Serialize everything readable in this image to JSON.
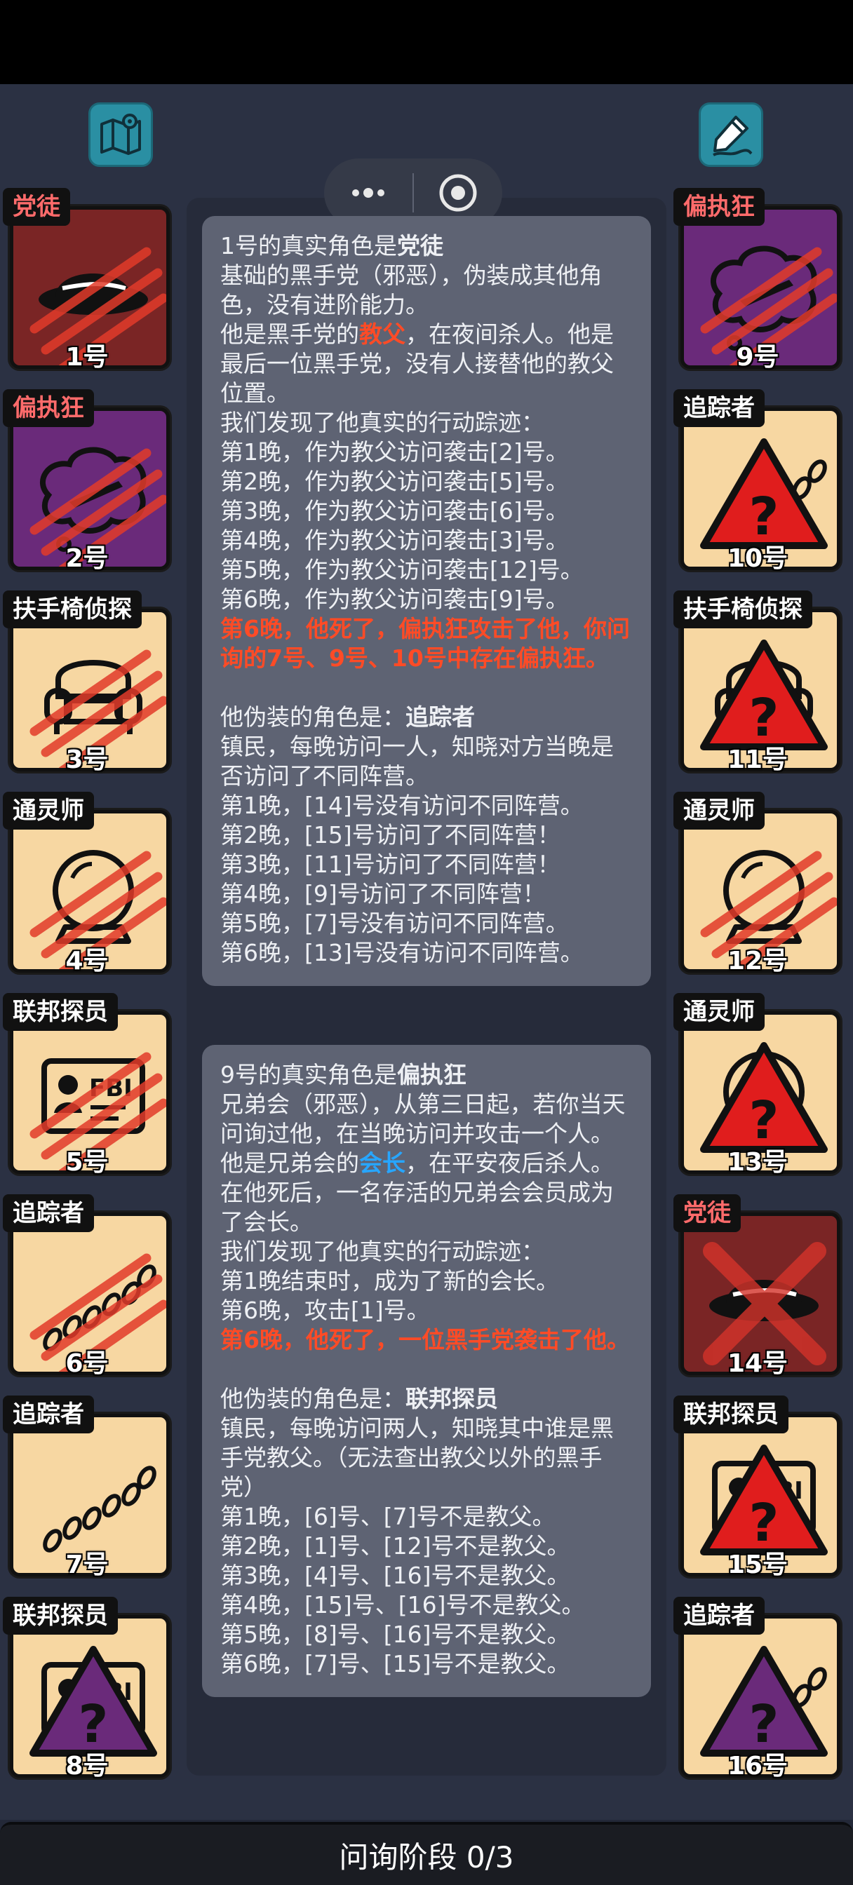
{
  "header": {
    "map_button": "map-icon",
    "notes_button": "edit-notes-icon",
    "capsule": {
      "more": "more-dots-icon",
      "close": "target-close-icon"
    }
  },
  "colors": {
    "card_bg": "#5e6373",
    "tile_beige": "#f7d7a2",
    "tile_purple": "#6a2a7a",
    "tile_red": "#7a2525",
    "highlight_red": "#ff4b26",
    "highlight_blue": "#27a6ff",
    "tag_red": "#ff6b6b"
  },
  "left_roles": [
    {
      "tag": "党徒",
      "num": "1号",
      "bg": "red",
      "icon": "hat-icon",
      "state": "scratched",
      "tag_red": true
    },
    {
      "tag": "偏执狂",
      "num": "2号",
      "bg": "purple",
      "icon": "thought-knife-icon",
      "state": "scratched",
      "tag_red": true
    },
    {
      "tag": "扶手椅侦探",
      "num": "3号",
      "bg": "beige",
      "icon": "armchair-icon",
      "state": "scratched",
      "tag_red": false
    },
    {
      "tag": "通灵师",
      "num": "4号",
      "bg": "beige",
      "icon": "crystal-ball-icon",
      "state": "scratched",
      "tag_red": false
    },
    {
      "tag": "联邦探员",
      "num": "5号",
      "bg": "beige",
      "icon": "fbi-badge-icon",
      "state": "scratched",
      "tag_red": false
    },
    {
      "tag": "追踪者",
      "num": "6号",
      "bg": "beige",
      "icon": "footprints-icon",
      "state": "scratched",
      "tag_red": false
    },
    {
      "tag": "追踪者",
      "num": "7号",
      "bg": "beige",
      "icon": "footprints-icon",
      "state": "normal",
      "tag_red": false
    },
    {
      "tag": "联邦探员",
      "num": "8号",
      "bg": "beige",
      "icon": "fbi-badge-icon",
      "state": "unknown-purple",
      "tag_red": false
    }
  ],
  "right_roles": [
    {
      "tag": "偏执狂",
      "num": "9号",
      "bg": "purple",
      "icon": "thought-knife-icon",
      "state": "scratched",
      "tag_red": true
    },
    {
      "tag": "追踪者",
      "num": "10号",
      "bg": "beige",
      "icon": "footprints-icon",
      "state": "unknown-red",
      "tag_red": false
    },
    {
      "tag": "扶手椅侦探",
      "num": "11号",
      "bg": "beige",
      "icon": "armchair-icon",
      "state": "unknown-red",
      "tag_red": false
    },
    {
      "tag": "通灵师",
      "num": "12号",
      "bg": "beige",
      "icon": "crystal-ball-icon",
      "state": "scratched",
      "tag_red": false
    },
    {
      "tag": "通灵师",
      "num": "13号",
      "bg": "beige",
      "icon": "crystal-ball-icon",
      "state": "unknown-red",
      "tag_red": false
    },
    {
      "tag": "党徒",
      "num": "14号",
      "bg": "red",
      "icon": "hat-icon",
      "state": "crossed",
      "tag_red": true
    },
    {
      "tag": "联邦探员",
      "num": "15号",
      "bg": "beige",
      "icon": "fbi-badge-icon",
      "state": "unknown-red",
      "tag_red": false
    },
    {
      "tag": "追踪者",
      "num": "16号",
      "bg": "beige",
      "icon": "footprints-icon",
      "state": "unknown-purple",
      "tag_red": false
    }
  ],
  "card1": {
    "title_prefix": "1号的真实角色是",
    "title_role": "党徒",
    "desc1": "基础的黑手党（邪恶），伪装成其他角色，没有进阶能力。",
    "desc2_pre": "他是黑手党的",
    "desc2_hl": "教父",
    "desc2_post": "，在夜间杀人。他是最后一位黑手党，没有人接替他的教父位置。",
    "track_intro": "我们发现了他真实的行动踪迹：",
    "tracks": [
      "第1晚，作为教父访问袭击[2]号。",
      "第2晚，作为教父访问袭击[5]号。",
      "第3晚，作为教父访问袭击[6]号。",
      "第4晚，作为教父访问袭击[3]号。",
      "第5晚，作为教父访问袭击[12]号。",
      "第6晚，作为教父访问袭击[9]号。"
    ],
    "death": "第6晚，他死了，偏执狂攻击了他，你问询的7号、9号、10号中存在偏执狂。",
    "disguise_prefix": "他伪装的角色是：",
    "disguise_role": "追踪者",
    "disguise_desc": "镇民，每晚访问一人，知晓对方当晚是否访问了不同阵营。",
    "disguise_lines": [
      "第1晚，[14]号没有访问不同阵营。",
      "第2晚，[15]号访问了不同阵营！",
      "第3晚，[11]号访问了不同阵营！",
      "第4晚，[9]号访问了不同阵营！",
      "第5晚，[7]号没有访问不同阵营。",
      "第6晚，[13]号没有访问不同阵营。"
    ]
  },
  "card2": {
    "title_prefix": "9号的真实角色是",
    "title_role": "偏执狂",
    "desc1": "兄弟会（邪恶），从第三日起，若你当天问询过他，在当晚访问并攻击一个人。",
    "desc2_pre": "他是兄弟会的",
    "desc2_hl": "会长",
    "desc2_post": "，在平安夜后杀人。在他死后，一名存活的兄弟会会员成为了会长。",
    "track_intro": "我们发现了他真实的行动踪迹：",
    "tracks": [
      "第1晚结束时，成为了新的会长。",
      "第6晚，攻击[1]号。"
    ],
    "death": "第6晚，他死了，一位黑手党袭击了他。",
    "disguise_prefix": "他伪装的角色是：",
    "disguise_role": "联邦探员",
    "disguise_desc": "镇民，每晚访问两人，知晓其中谁是黑手党教父。（无法查出教父以外的黑手党）",
    "disguise_lines": [
      "第1晚，[6]号、[7]号不是教父。",
      "第2晚，[1]号、[12]号不是教父。",
      "第3晚，[4]号、[16]号不是教父。",
      "第4晚，[15]号、[16]号不是教父。",
      "第5晚，[8]号、[16]号不是教父。",
      "第6晚，[7]号、[15]号不是教父。"
    ]
  },
  "footer": {
    "phase": "问询阶段 0/3"
  }
}
